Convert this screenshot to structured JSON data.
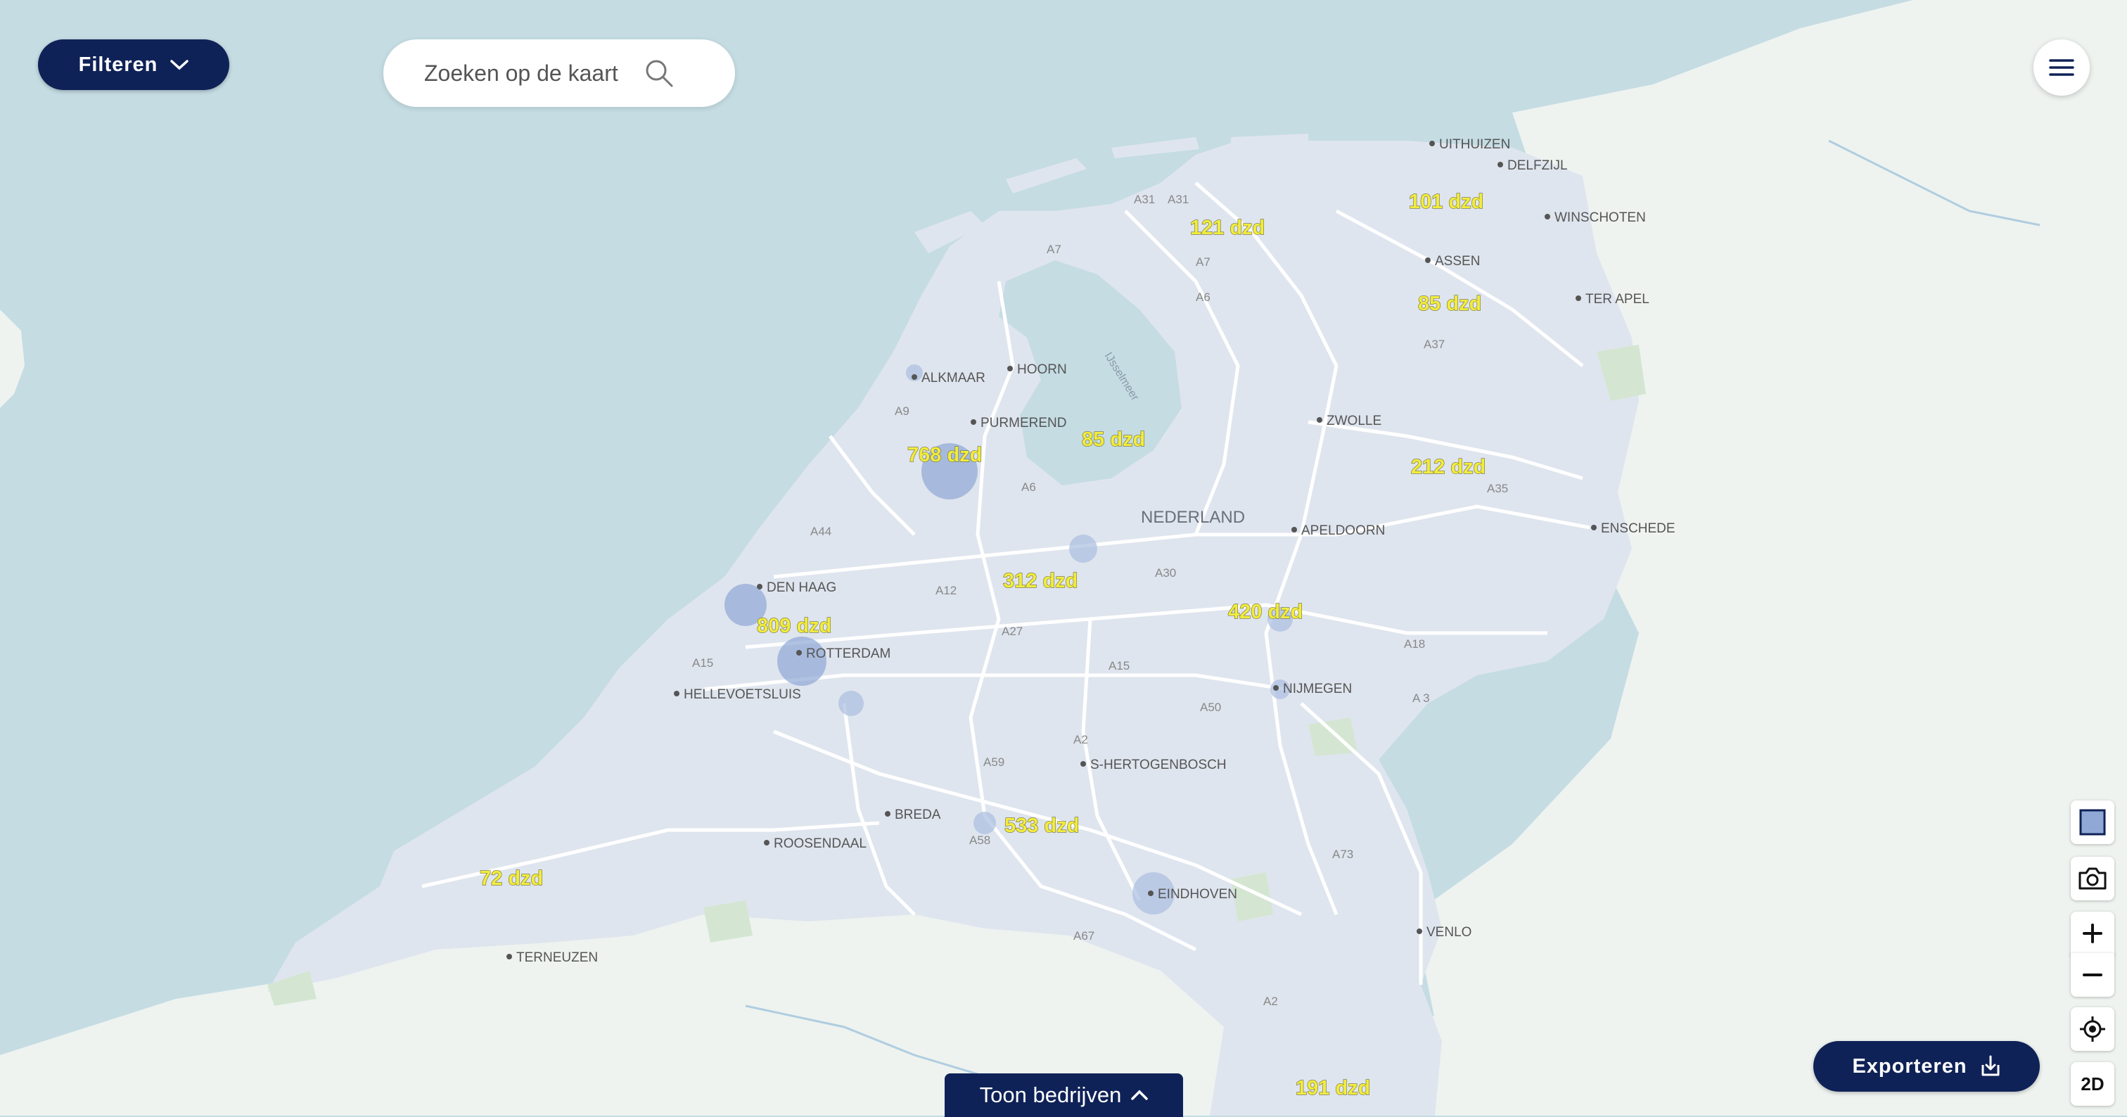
{
  "header": {
    "filter_label": "Filteren",
    "search_placeholder": "Zoeken op de kaart"
  },
  "map": {
    "country_label": "NEDERLAND",
    "water_label": "IJsselmeer",
    "cities": [
      {
        "name": "UITHUIZEN"
      },
      {
        "name": "DELFZIJL"
      },
      {
        "name": "WINSCHOTEN"
      },
      {
        "name": "ASSEN"
      },
      {
        "name": "TER APEL"
      },
      {
        "name": "ALKMAAR"
      },
      {
        "name": "HOORN"
      },
      {
        "name": "PURMEREND"
      },
      {
        "name": "ZWOLLE"
      },
      {
        "name": "APELDOORN"
      },
      {
        "name": "ENSCHEDE"
      },
      {
        "name": "DEN HAAG"
      },
      {
        "name": "ROTTERDAM"
      },
      {
        "name": "HELLEVOETSLUIS"
      },
      {
        "name": "NIJMEGEN"
      },
      {
        "name": "S-HERTOGENBOSCH"
      },
      {
        "name": "BREDA"
      },
      {
        "name": "ROOSENDAAL"
      },
      {
        "name": "EINDHOVEN"
      },
      {
        "name": "VENLO"
      },
      {
        "name": "TERNEUZEN"
      }
    ],
    "roads": [
      "A31",
      "A31",
      "A7",
      "A7",
      "A6",
      "A37",
      "A9",
      "A6",
      "A35",
      "A44",
      "A12",
      "A30",
      "A27",
      "A15",
      "A15",
      "A18",
      "A 3",
      "A50",
      "A2",
      "A59",
      "A58",
      "A73",
      "A67",
      "A2"
    ],
    "clusters": [
      {
        "label": "121 dzd"
      },
      {
        "label": "101 dzd"
      },
      {
        "label": "85 dzd"
      },
      {
        "label": "768 dzd"
      },
      {
        "label": "85 dzd"
      },
      {
        "label": "212 dzd"
      },
      {
        "label": "312 dzd"
      },
      {
        "label": "420 dzd"
      },
      {
        "label": "809 dzd"
      },
      {
        "label": "533 dzd"
      },
      {
        "label": "72 dzd"
      },
      {
        "label": "191 dzd"
      }
    ]
  },
  "controls": {
    "view_mode_label": "2D",
    "export_label": "Exporteren",
    "toon_label": "Toon bedrijven"
  },
  "colors": {
    "water": "#c5dce3",
    "land": "#dfe5ee",
    "foreign_land": "#eef3f0",
    "accent": "#0f2257",
    "cluster_text": "#f2ec3c"
  },
  "icons": {
    "filter": "chevron-down-icon",
    "search": "search-icon",
    "menu": "hamburger-menu-icon",
    "layer": "layer-square-icon",
    "screenshot": "camera-icon",
    "zoom_in": "plus-icon",
    "zoom_out": "minus-icon",
    "locate": "locate-icon",
    "export": "download-icon",
    "toon": "chevron-up-icon"
  }
}
